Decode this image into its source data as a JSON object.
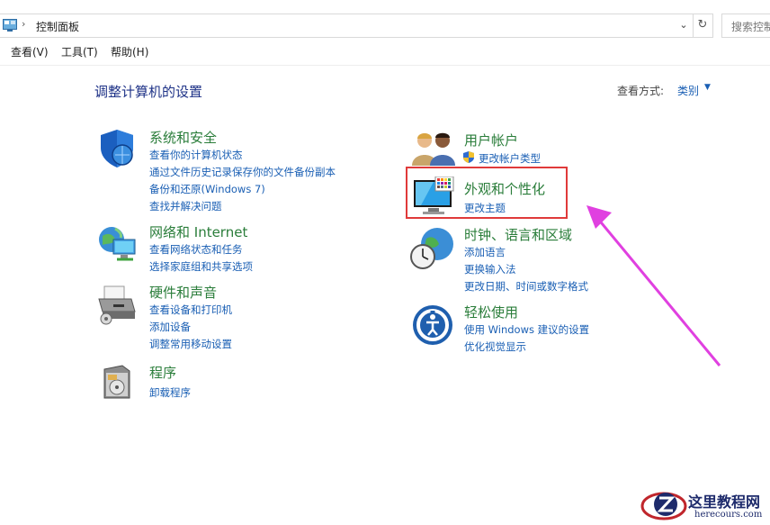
{
  "address": {
    "path": "控制面板",
    "separator": "›",
    "search_placeholder": "搜索控制"
  },
  "menu": [
    "查看(V)",
    "工具(T)",
    "帮助(H)"
  ],
  "header": {
    "title": "调整计算机的设置",
    "view_by_label": "查看方式:",
    "view_by_value": "类别"
  },
  "categories": {
    "system_security": {
      "title": "系统和安全",
      "links": [
        "查看你的计算机状态",
        "通过文件历史记录保存你的文件备份副本",
        "备份和还原(Windows 7)",
        "查找并解决问题"
      ]
    },
    "network": {
      "title": "网络和 Internet",
      "links": [
        "查看网络状态和任务",
        "选择家庭组和共享选项"
      ]
    },
    "hardware": {
      "title": "硬件和声音",
      "links": [
        "查看设备和打印机",
        "添加设备",
        "调整常用移动设置"
      ]
    },
    "programs": {
      "title": "程序",
      "links": [
        "卸载程序"
      ]
    },
    "user_accounts": {
      "title": "用户帐户",
      "links": [
        "更改帐户类型"
      ]
    },
    "appearance": {
      "title": "外观和个性化",
      "links": [
        "更改主题"
      ]
    },
    "clock_region": {
      "title": "时钟、语言和区域",
      "links": [
        "添加语言",
        "更换输入法",
        "更改日期、时间或数字格式"
      ]
    },
    "ease_access": {
      "title": "轻松使用",
      "links": [
        "使用 Windows 建议的设置",
        "优化视觉显示"
      ]
    }
  },
  "watermark": {
    "name": "这里教程网",
    "url": "herecours.com"
  },
  "colors": {
    "link": "#1a5fb4",
    "category_title": "#2a7d3a",
    "title": "#1e3287",
    "highlight": "#e03a3a",
    "arrow": "#e040e0"
  }
}
